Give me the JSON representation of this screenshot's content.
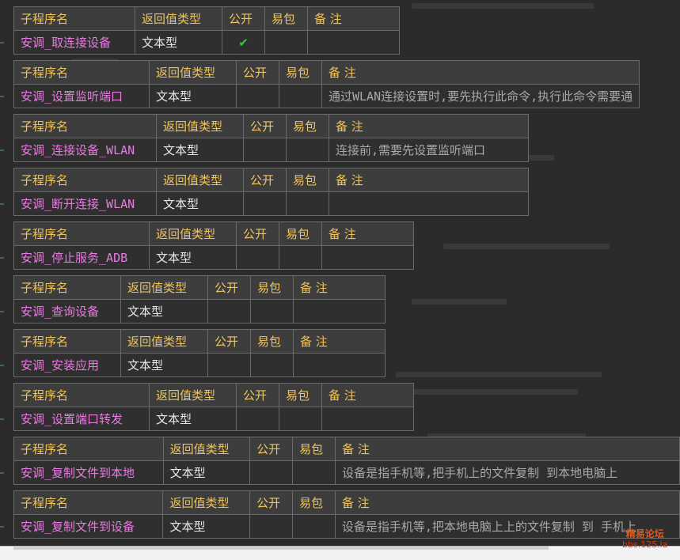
{
  "headers": {
    "name": "子程序名",
    "return": "返回值类型",
    "public": "公开",
    "easy": "易包",
    "note": "备 注"
  },
  "subs": [
    {
      "name": "安调_取连接设备",
      "ret": "文本型",
      "pub": "✔",
      "easy": "",
      "note": ""
    },
    {
      "name": "安调_设置监听端口",
      "ret": "文本型",
      "pub": "",
      "easy": "",
      "note": "通过WLAN连接设置时,要先执行此命令,执行此命令需要通"
    },
    {
      "name": "安调_连接设备_WLAN",
      "ret": "文本型",
      "pub": "",
      "easy": "",
      "note": "连接前,需要先设置监听端口"
    },
    {
      "name": "安调_断开连接_WLAN",
      "ret": "文本型",
      "pub": "",
      "easy": "",
      "note": ""
    },
    {
      "name": "安调_停止服务_ADB",
      "ret": "文本型",
      "pub": "",
      "easy": "",
      "note": ""
    },
    {
      "name": "安调_查询设备",
      "ret": "文本型",
      "pub": "",
      "easy": "",
      "note": ""
    },
    {
      "name": "安调_安装应用",
      "ret": "文本型",
      "pub": "",
      "easy": "",
      "note": ""
    },
    {
      "name": "安调_设置端口转发",
      "ret": "文本型",
      "pub": "",
      "easy": "",
      "note": ""
    },
    {
      "name": "安调_复制文件到本地",
      "ret": "文本型",
      "pub": "",
      "easy": "",
      "note": "设备是指手机等,把手机上的文件复制 到本地电脑上"
    },
    {
      "name": "安调_复制文件到设备",
      "ret": "文本型",
      "pub": "",
      "easy": "",
      "note": "设备是指手机等,把本地电脑上上的文件复制 到 手机上"
    }
  ],
  "watermark": {
    "line1": "精易论坛",
    "line2": "bbs.125.la"
  }
}
